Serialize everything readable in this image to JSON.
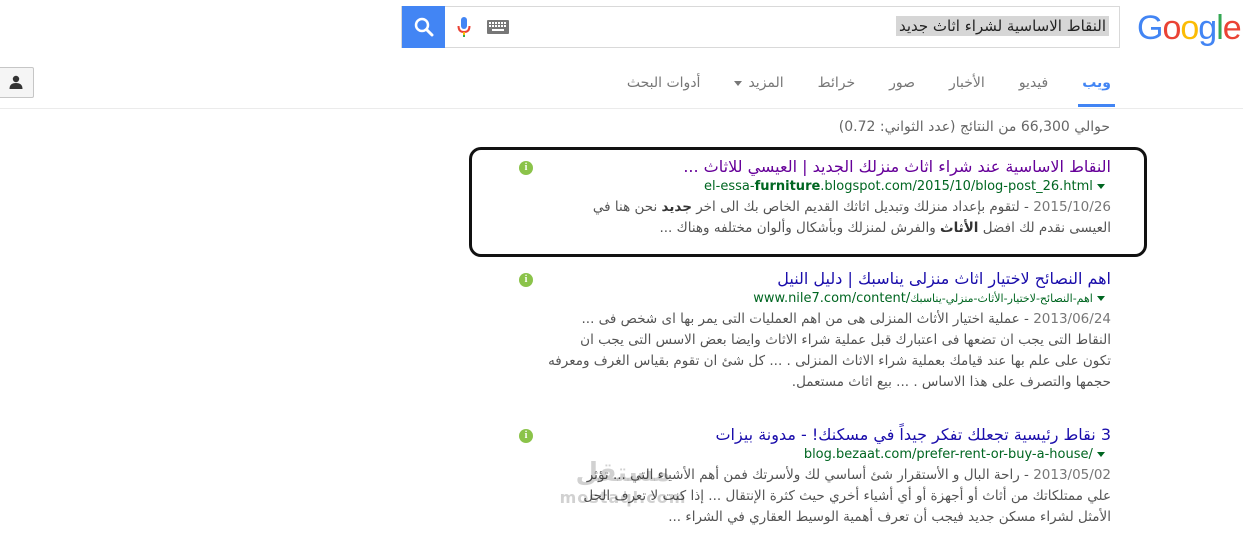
{
  "logo": {
    "letters": [
      "G",
      "o",
      "o",
      "g",
      "l",
      "e"
    ]
  },
  "search": {
    "query": "النقاط الاساسية لشراء اثاث جديد",
    "colors": {
      "button": "#4285f4"
    }
  },
  "tabs": [
    {
      "label": "ويب",
      "active": true
    },
    {
      "label": "فيديو"
    },
    {
      "label": "الأخبار"
    },
    {
      "label": "صور"
    },
    {
      "label": "خرائط"
    },
    {
      "label": "المزيد"
    },
    {
      "label": "أدوات البحث"
    }
  ],
  "stats": "حوالي 66,300 من النتائج (عدد الثواني: 0.72)",
  "results": [
    {
      "title": "النقاط الاساسية عند شراء اثاث منزلك الجديد | العيسي للاثاث ...",
      "url_pre": "el-essa-",
      "url_bold": "furniture",
      "url_post": ".blogspot.com/2015/10/blog-post_26.html",
      "date": "2015/10/26",
      "line1_a": " - لتقوم بإعداد منزلك وتبديل اثاثك القديم الخاص بك الى اخر ",
      "line1_b": "جديد",
      "line1_c": " نحن هنا في",
      "line2_a": "العيسى نقدم لك افضل ",
      "line2_b": "الأثاث",
      "line2_c": " والفرش لمنزلك وبأشكال وألوان مختلفه وهناك ..."
    },
    {
      "title": "اهم النصائح لاختيار اثاث منزلى يناسبك | دليل النيل",
      "url_pre": "www.nile7.com/content/",
      "url_bold": "",
      "url_post": "اهم-النصائح-لاختيار-الأثاث-منزلي-يناسبك",
      "date": "2013/06/24",
      "line1": " - عملية اختيار الأثاث المنزلى هى من اهم العمليات التى يمر بها اى شخص فى ...",
      "line2": "النقاط التى يجب ان تضعها فى اعتبارك قبل عملية شراء الاثاث وايضا بعض الاسس التى يجب ان",
      "line3": "تكون على علم بها عند قيامك بعملية شراء الاثاث المنزلى . ... كل شئ ان تقوم بقياس الغرف ومعرفه",
      "line4": "حجمها والتصرف على هذا الاساس . ... بيع اثاث مستعمل."
    },
    {
      "title": "3 نقاط رئيسية تجعلك تفكر جيداً في مسكنك! - مدونة بيزات",
      "url": "blog.bezaat.com/prefer-rent-or-buy-a-house/",
      "date": "2013/05/02",
      "line1": " - راحة البال و الأستقرار شئ أساسي لك ولأسرتك فمن أهم الأشياء التي ... تؤثر",
      "line2": "علي ممتلكاتك من أثاث أو أجهزة أو أي أشياء أخري حيث كثرة الإنتقال ... إذا كنت لا تعرف الحل",
      "line3": "الأمثل لشراء مسكن جديد فيجب أن تعرف أهمية الوسيط العقاري في الشراء ..."
    }
  ],
  "watermark": {
    "arabic": "مستقل",
    "latin": "mostaql.com"
  }
}
